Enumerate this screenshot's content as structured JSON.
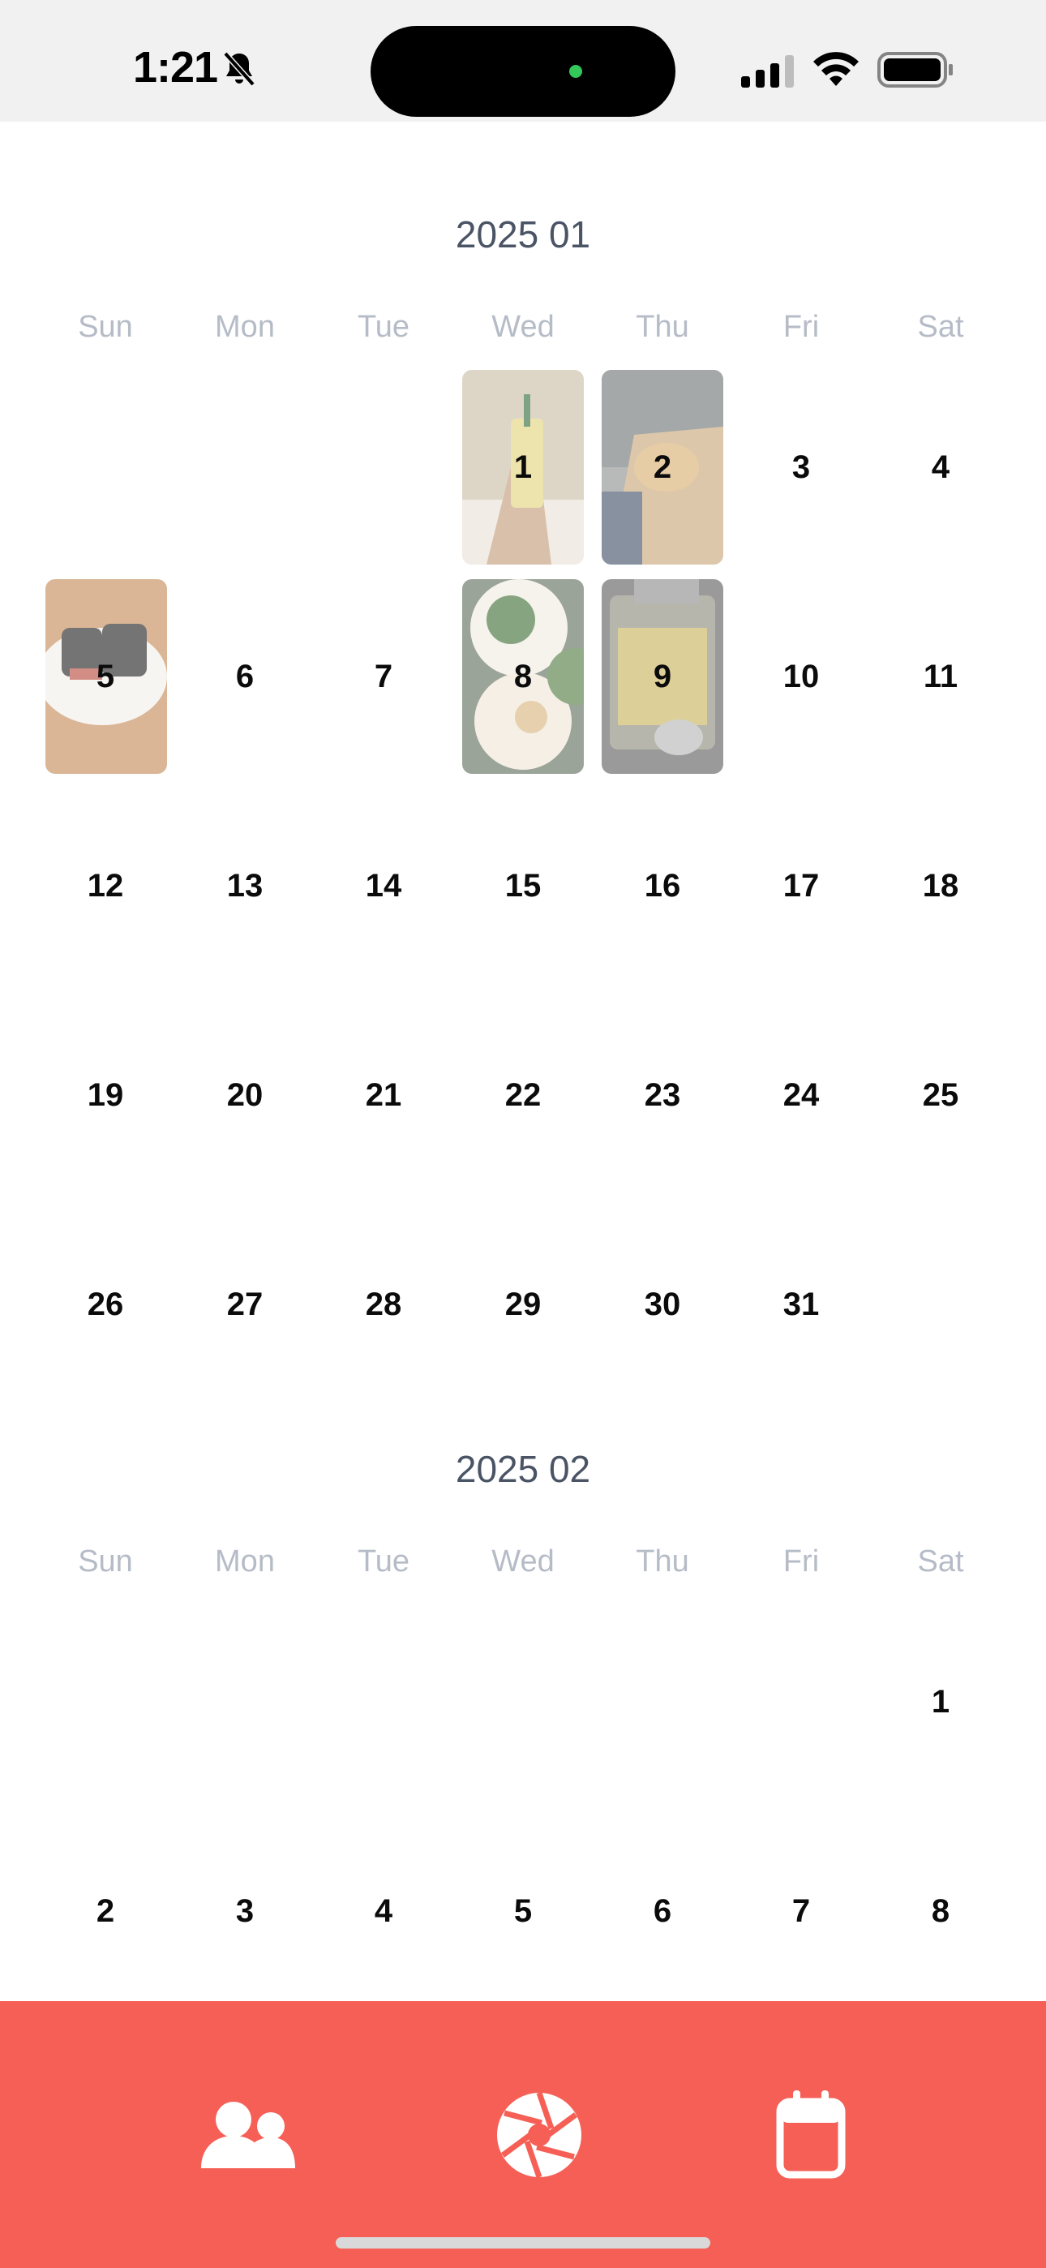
{
  "status_bar": {
    "time": "1:21"
  },
  "months": [
    {
      "title": "2025 01",
      "weekdays": [
        "Sun",
        "Mon",
        "Tue",
        "Wed",
        "Thu",
        "Fri",
        "Sat"
      ],
      "days": [
        "1",
        "2",
        "3",
        "4",
        "5",
        "6",
        "7",
        "8",
        "9",
        "10",
        "11",
        "12",
        "13",
        "14",
        "15",
        "16",
        "17",
        "18",
        "19",
        "20",
        "21",
        "22",
        "23",
        "24",
        "25",
        "26",
        "27",
        "28",
        "29",
        "30",
        "31"
      ],
      "photo_days": [
        "1",
        "2",
        "5",
        "8",
        "9"
      ]
    },
    {
      "title": "2025 02",
      "weekdays": [
        "Sun",
        "Mon",
        "Tue",
        "Wed",
        "Thu",
        "Fri",
        "Sat"
      ],
      "days": [
        "1",
        "2",
        "3",
        "4",
        "5",
        "6",
        "7",
        "8"
      ]
    }
  ],
  "tabbar": {
    "tabs": [
      {
        "name": "friends",
        "icon": "people-icon"
      },
      {
        "name": "camera",
        "icon": "aperture-icon"
      },
      {
        "name": "calendar",
        "icon": "calendar-icon"
      }
    ],
    "background": "#f65f56"
  }
}
